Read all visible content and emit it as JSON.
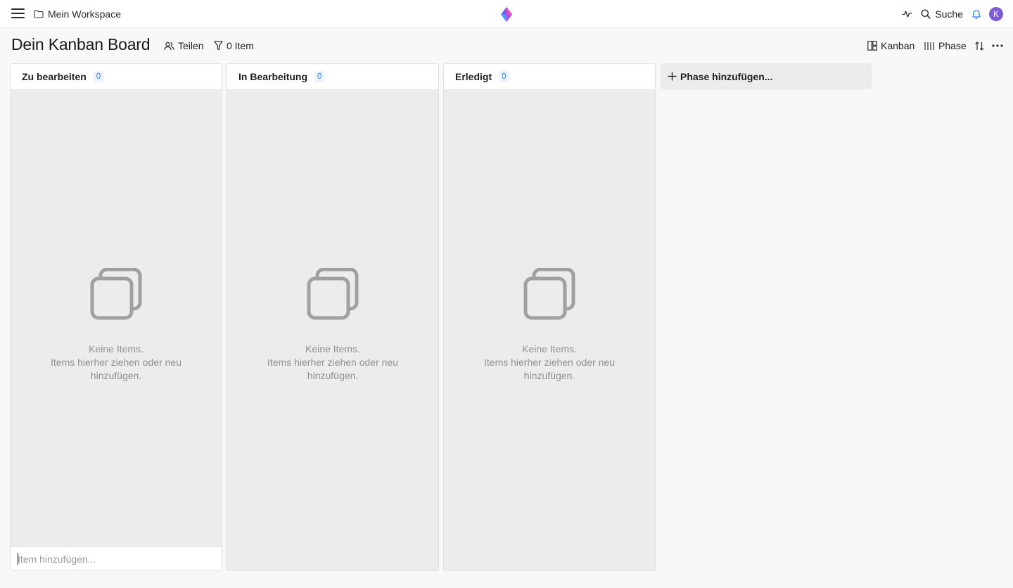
{
  "topbar": {
    "breadcrumb": "Mein Workspace",
    "search_label": "Suche",
    "avatar_initial": "K"
  },
  "header": {
    "title": "Dein Kanban Board",
    "share_label": "Teilen",
    "filter_label": "0 Item",
    "view_label": "Kanban",
    "group_label": "Phase"
  },
  "columns": [
    {
      "title": "Zu bearbeiten",
      "count": "0",
      "empty_line1": "Keine Items.",
      "empty_line2": "Items hierher ziehen oder neu",
      "empty_line3": "hinzufügen."
    },
    {
      "title": "In Bearbeitung",
      "count": "0",
      "empty_line1": "Keine Items.",
      "empty_line2": "Items hierher ziehen oder neu",
      "empty_line3": "hinzufügen."
    },
    {
      "title": "Erledigt",
      "count": "0",
      "empty_line1": "Keine Items.",
      "empty_line2": "Items hierher ziehen oder neu",
      "empty_line3": "hinzufügen."
    }
  ],
  "add_item": {
    "placeholder": "Item hinzufügen...",
    "value": ""
  },
  "add_phase_label": "Phase hinzufügen...",
  "icons": {
    "menu": "hamburger-icon",
    "folder": "folder-icon",
    "logo": "diamond-logo",
    "activity": "activity-icon",
    "search": "search-icon",
    "notifications": "bell-icon",
    "share": "share-icon",
    "filter": "filter-icon",
    "view": "kanban-icon",
    "group": "columns-icon",
    "sort": "sort-icon",
    "more": "more-icon",
    "empty": "stacked-squares-icon",
    "add": "plus-icon"
  },
  "colors": {
    "accent": "#2d7ff0",
    "avatar": "#7e5bd6",
    "column_bg": "#ececec",
    "page_bg": "#f8f8f8"
  }
}
